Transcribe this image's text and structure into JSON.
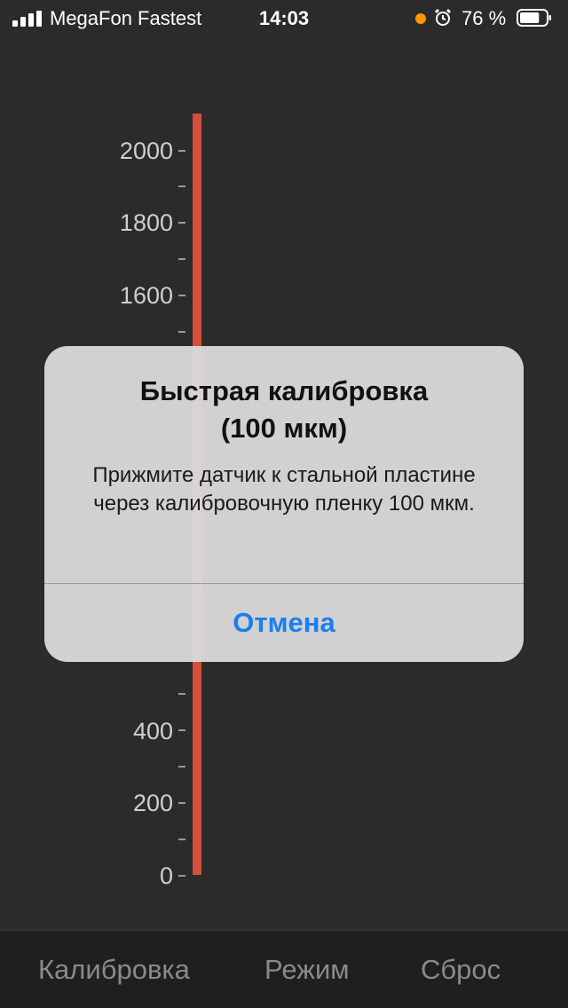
{
  "status_bar": {
    "carrier": "MegaFon Fastest",
    "time": "14:03",
    "battery": "76 %",
    "battery_level": 0.76,
    "recording_dot_color": "#ff9500"
  },
  "scale": {
    "bar_color": "#d4503c",
    "min": 0,
    "max": 2100,
    "labels": [
      "2000",
      "1800",
      "1600",
      "400",
      "200",
      "0"
    ]
  },
  "alert": {
    "title_line1": "Быстрая калибровка",
    "title_line2": "(100 мкм)",
    "message": "Прижмите датчик к стальной пластине через калибровочную пленку 100 мкм.",
    "cancel_label": "Отмена",
    "button_color": "#1a7ff0"
  },
  "toolbar": {
    "calibration_label": "Калибровка",
    "mode_label": "Режим",
    "reset_label": "Сброс"
  }
}
